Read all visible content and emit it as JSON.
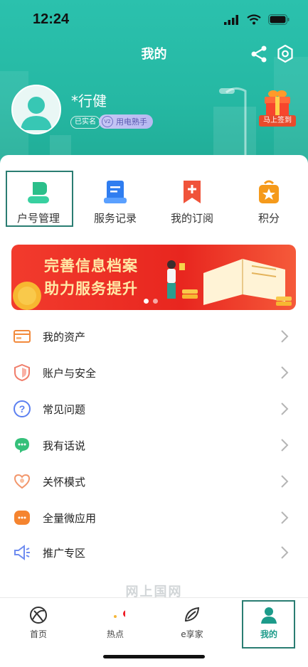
{
  "status_bar": {
    "time": "12:24"
  },
  "header": {
    "title": "我的"
  },
  "profile": {
    "name": "*行健",
    "verified_badge": "已实名",
    "level_badge_icon": "V2",
    "level_badge": "用电熟手",
    "sign_in_label": "马上签到"
  },
  "quick_actions": [
    {
      "label": "户号管理",
      "icon": "person-icon",
      "color": "#2bbf8a"
    },
    {
      "label": "服务记录",
      "icon": "record-icon",
      "color": "#2f7df0"
    },
    {
      "label": "我的订阅",
      "icon": "bookmark-icon",
      "color": "#f0533a"
    },
    {
      "label": "积分",
      "icon": "star-bag-icon",
      "color": "#f59a1b"
    }
  ],
  "banner": {
    "line1": "完善信息档案",
    "line2": "助力服务提升"
  },
  "menu_items": [
    {
      "label": "我的资产",
      "icon": "card-icon"
    },
    {
      "label": "账户与安全",
      "icon": "shield-icon"
    },
    {
      "label": "常见问题",
      "icon": "question-icon"
    },
    {
      "label": "我有话说",
      "icon": "chat-icon"
    },
    {
      "label": "关怀模式",
      "icon": "heart-icon"
    },
    {
      "label": "全量微应用",
      "icon": "apps-icon"
    },
    {
      "label": "推广专区",
      "icon": "megaphone-icon"
    }
  ],
  "watermark": "网上国网",
  "tabs": [
    {
      "label": "首页",
      "icon": "globe-icon"
    },
    {
      "label": "热点",
      "icon": "hot-icon"
    },
    {
      "label": "e享家",
      "icon": "leaf-icon"
    },
    {
      "label": "我的",
      "icon": "profile-icon"
    }
  ],
  "colors": {
    "accent": "#25b8a3",
    "active_tab": "#1c9b8a"
  }
}
